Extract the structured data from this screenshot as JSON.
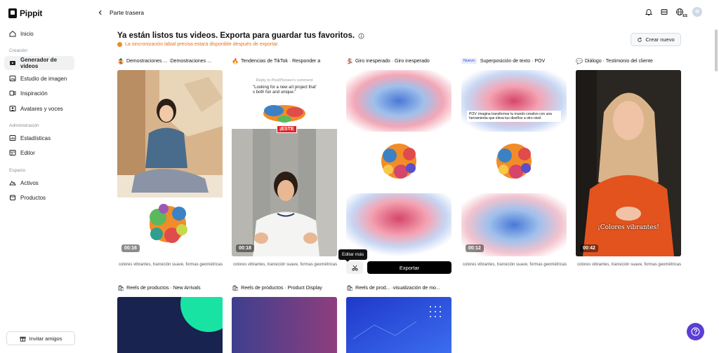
{
  "app": {
    "name": "Pippit"
  },
  "sidebar": {
    "items": [
      {
        "label": "Inicio",
        "icon": "home-icon"
      },
      {
        "label": "Generador de videos",
        "icon": "video-generator-icon",
        "active": true
      },
      {
        "label": "Estudio de imagen",
        "icon": "image-studio-icon"
      },
      {
        "label": "Inspiración",
        "icon": "inspiration-icon"
      },
      {
        "label": "Avatares y voces",
        "icon": "avatar-voice-icon"
      },
      {
        "label": "Estadísticas",
        "icon": "stats-icon"
      },
      {
        "label": "Editor",
        "icon": "editor-icon"
      },
      {
        "label": "Activos",
        "icon": "assets-icon"
      },
      {
        "label": "Productos",
        "icon": "products-icon"
      }
    ],
    "sections": [
      "Creación",
      "Administración",
      "Espacio"
    ],
    "invite_label": "Invitar amigos"
  },
  "topbar": {
    "title": "Parte trasera",
    "lang_code": "ES"
  },
  "main": {
    "heading": "Ya están listos tus videos. Exporta para guardar tus favoritos.",
    "sync_note": "La sincronización labial precisa estará disponible después de exportar.",
    "create_label": "Crear nuevo",
    "tooltip": "Editar más",
    "export_label": "Exportar",
    "cards": [
      {
        "title": "Demostraciones ... ·Demostraciones ...",
        "emoji": "🤹",
        "duration": "00:16",
        "tags": "colores vibrantes, transición suave, formas geométricas"
      },
      {
        "title": "Tendencias de TikTok · Responder a",
        "emoji": "🔥",
        "duration": "00:18",
        "tags": "colores vibrantes, transición suave, formas geométricas",
        "reply_header": "Reply to PixelPioneer's comment",
        "reply_text": "\"Looking for a new art project that' s both fun and unique.\"",
        "sticker": "¡ESTE"
      },
      {
        "title": "Giro inesperado · Giro inesperado",
        "emoji": "🏂",
        "duration": "",
        "tags": ""
      },
      {
        "title": "Superposición de texto · POV",
        "badge": "Nuevo",
        "duration": "00:12",
        "tags": "colores vibrantes, transición suave, formas geométricas",
        "overlay": "POV: imagina transformar tu mundo creativo con una herramienta que eleva tus diseños a otro nivel."
      },
      {
        "title": "Diálogo · Testimonio del cliente",
        "emoji": "💬",
        "duration": "00:42",
        "tags": "colores vibrantes, transición suave, formas geométricas",
        "caption": "¡Colores vibrantes!"
      },
      {
        "title": "Reels de productos · New Arrivals",
        "emoji": "🛍"
      },
      {
        "title": "Reels de productos · Product Display",
        "emoji": "🛍"
      },
      {
        "title": "Reels de prod... ·visualización de mo...",
        "emoji": "🛍"
      }
    ]
  },
  "colors": {
    "accent": "#5b3fd1",
    "warning": "#e8711c",
    "export": "#000000"
  }
}
